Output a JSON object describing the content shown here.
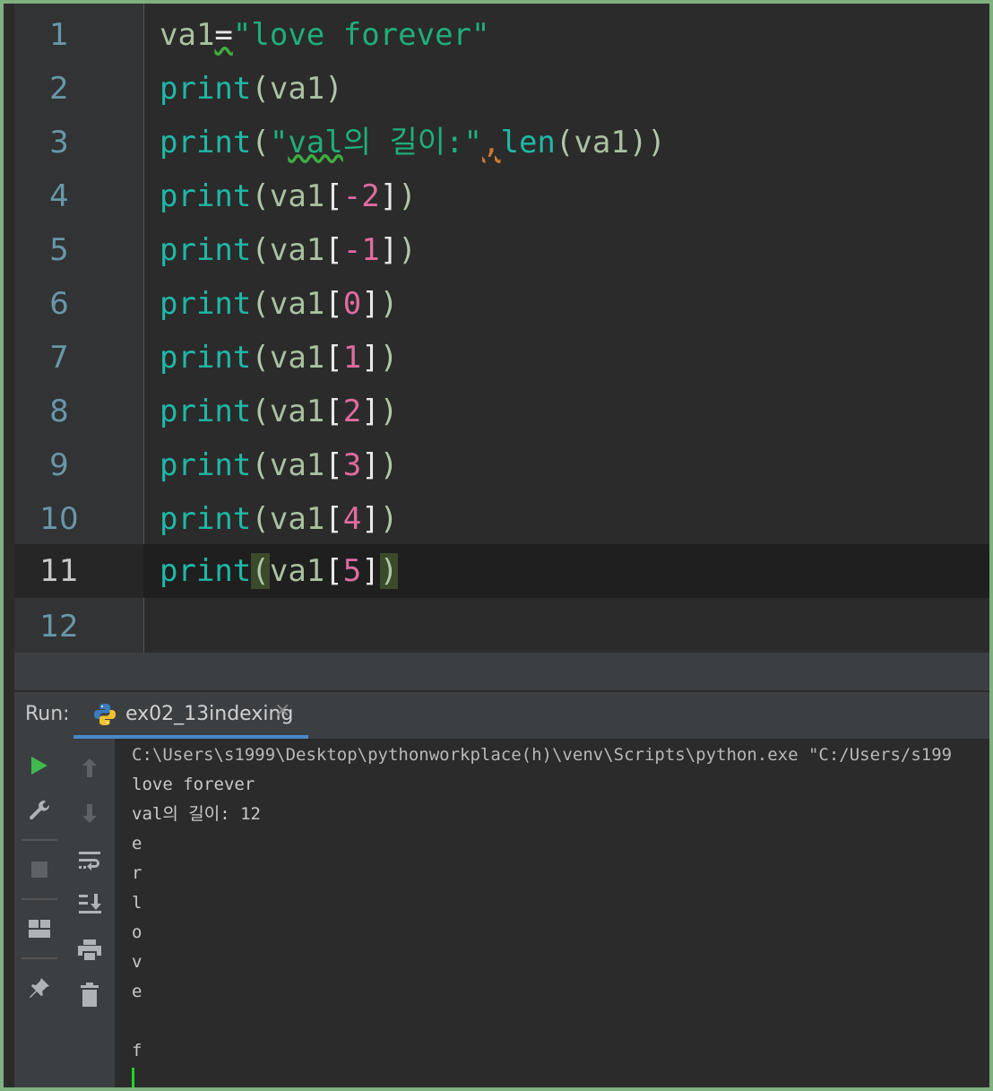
{
  "editor": {
    "lines": [
      {
        "num": "1"
      },
      {
        "num": "2"
      },
      {
        "num": "3"
      },
      {
        "num": "4"
      },
      {
        "num": "5"
      },
      {
        "num": "6"
      },
      {
        "num": "7"
      },
      {
        "num": "8"
      },
      {
        "num": "9"
      },
      {
        "num": "10"
      },
      {
        "num": "11"
      },
      {
        "num": "12"
      }
    ],
    "code": {
      "l1": {
        "var": "va1",
        "eq": "=",
        "str": "\"love forever\""
      },
      "l2": {
        "fn": "print",
        "open": "(",
        "arg": "va1",
        "close": ")"
      },
      "l3": {
        "fn": "print",
        "open": "(",
        "str_a": "\"",
        "str_b": "val",
        "str_c": "의 길이:\"",
        "comma": ",",
        "fn2": "len",
        "open2": "(",
        "arg": "va1",
        "close": "))"
      },
      "l4": {
        "fn": "print",
        "open": "(",
        "arg": "va1",
        "lb": "[",
        "idx": "-2",
        "rb": "]",
        "close": ")"
      },
      "l5": {
        "fn": "print",
        "open": "(",
        "arg": "va1",
        "lb": "[",
        "idx": "-1",
        "rb": "]",
        "close": ")"
      },
      "l6": {
        "fn": "print",
        "open": "(",
        "arg": "va1",
        "lb": "[",
        "idx": "0",
        "rb": "]",
        "close": ")"
      },
      "l7": {
        "fn": "print",
        "open": "(",
        "arg": "va1",
        "lb": "[",
        "idx": "1",
        "rb": "]",
        "close": ")"
      },
      "l8": {
        "fn": "print",
        "open": "(",
        "arg": "va1",
        "lb": "[",
        "idx": "2",
        "rb": "]",
        "close": ")"
      },
      "l9": {
        "fn": "print",
        "open": "(",
        "arg": "va1",
        "lb": "[",
        "idx": "3",
        "rb": "]",
        "close": ")"
      },
      "l10": {
        "fn": "print",
        "open": "(",
        "arg": "va1",
        "lb": "[",
        "idx": "4",
        "rb": "]",
        "close": ")"
      },
      "l11": {
        "fn": "print",
        "open": "(",
        "arg": "va1",
        "lb": "[",
        "idx": "5",
        "rb": "]",
        "close": ")"
      }
    }
  },
  "run_panel": {
    "label": "Run:",
    "tab": {
      "label": "ex02_13indexing",
      "close": "×"
    },
    "output": [
      "C:\\Users\\s1999\\Desktop\\pythonworkplace(h)\\venv\\Scripts\\python.exe \"C:/Users/s199",
      "love forever",
      "val의 길이: 12",
      "e",
      "r",
      "l",
      "o",
      "v",
      "e",
      "",
      "f"
    ]
  },
  "icons": {
    "run": "play-icon",
    "up": "arrow-up-icon",
    "settings": "wrench-icon",
    "down": "arrow-down-icon",
    "wrap": "soft-wrap-icon",
    "stop": "stop-icon",
    "scroll": "scroll-to-end-icon",
    "layout": "layout-icon",
    "print": "print-icon",
    "pin": "pin-icon",
    "trash": "trash-icon"
  },
  "colors": {
    "accent": "#4a88c7",
    "run_green": "#3fb950",
    "caret": "#22d622"
  }
}
